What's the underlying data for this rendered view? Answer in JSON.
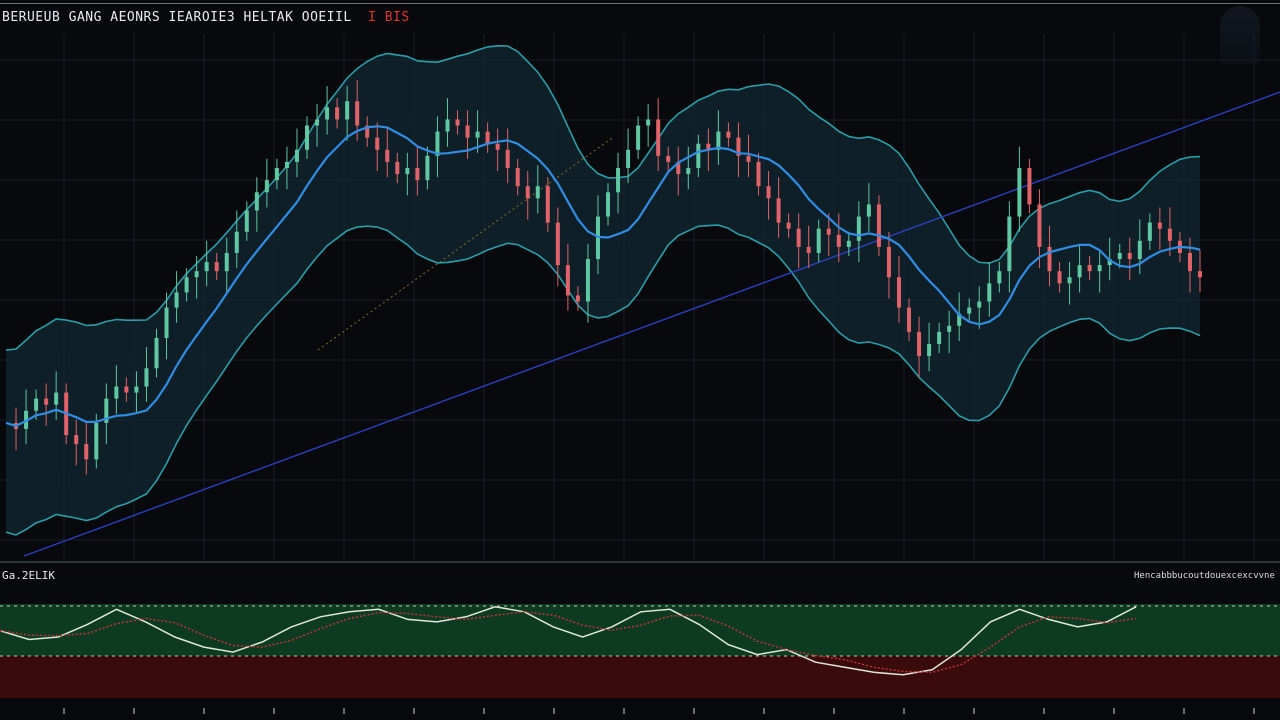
{
  "header": {
    "symbol_title": "BERUEUB GANG AEONRS IEAROIE3 HELTAK OOEIIL",
    "change_badge": "I BIS"
  },
  "oscillator": {
    "label": "Ga.2ELIK",
    "legend": "Hencabbbucoutdouexcexcvvnel"
  },
  "colors": {
    "background": "#07090c",
    "bullish": "#5fc7a2",
    "bearish": "#e0636a",
    "band": "#2a9ea8",
    "band_fill": "#122a35",
    "ma_fast": "#2f8de4",
    "ma_slow": "#2a3fc0",
    "osc_bull_zone": "#0d3b22",
    "osc_bear_zone": "#3a0b0b"
  },
  "chart_data": [
    {
      "type": "candlestick",
      "title": "",
      "indicators": [
        "bollinger_bands",
        "moving_average",
        "trend_line"
      ],
      "grid": true,
      "x": [
        0,
        10,
        20,
        30,
        40,
        50,
        60,
        70,
        80,
        90,
        100,
        110,
        120,
        130,
        140,
        150,
        160,
        170,
        180,
        190,
        200,
        210,
        220,
        230,
        240,
        250,
        260,
        270,
        280,
        290,
        300,
        310,
        320,
        330,
        340,
        350,
        360,
        370,
        380,
        390,
        400,
        410,
        420,
        430,
        440,
        450,
        460,
        470,
        480,
        490,
        500,
        510,
        520,
        530,
        540,
        550,
        560,
        570,
        580,
        590,
        600,
        610,
        620,
        630,
        640,
        650,
        660,
        670,
        680,
        690,
        700,
        710,
        720,
        730,
        740,
        750,
        760,
        770,
        780,
        790,
        800,
        810,
        820,
        830,
        840,
        850,
        860,
        870,
        880,
        890,
        900,
        910,
        920,
        930,
        940,
        950,
        960,
        970,
        980,
        990,
        1000,
        1010,
        1020,
        1030,
        1040,
        1050,
        1060,
        1070,
        1080,
        1090,
        1100,
        1110,
        1120,
        1130,
        1140,
        1150,
        1160,
        1170,
        1180,
        1190
      ],
      "close": [
        0.62,
        0.6,
        0.66,
        0.7,
        0.68,
        0.72,
        0.58,
        0.55,
        0.5,
        0.62,
        0.7,
        0.74,
        0.72,
        0.74,
        0.8,
        0.9,
        1.0,
        1.05,
        1.1,
        1.12,
        1.15,
        1.12,
        1.18,
        1.25,
        1.32,
        1.38,
        1.42,
        1.46,
        1.48,
        1.52,
        1.6,
        1.62,
        1.66,
        1.62,
        1.68,
        1.6,
        1.56,
        1.52,
        1.48,
        1.44,
        1.46,
        1.42,
        1.5,
        1.58,
        1.62,
        1.6,
        1.56,
        1.58,
        1.54,
        1.52,
        1.46,
        1.4,
        1.36,
        1.4,
        1.28,
        1.14,
        1.04,
        1.02,
        1.16,
        1.3,
        1.38,
        1.46,
        1.52,
        1.6,
        1.62,
        1.5,
        1.48,
        1.44,
        1.46,
        1.54,
        1.52,
        1.58,
        1.56,
        1.5,
        1.48,
        1.4,
        1.36,
        1.28,
        1.26,
        1.2,
        1.18,
        1.26,
        1.24,
        1.2,
        1.22,
        1.3,
        1.34,
        1.2,
        1.1,
        1.0,
        0.92,
        0.84,
        0.88,
        0.92,
        0.94,
        0.98,
        1.0,
        1.02,
        1.08,
        1.12,
        1.3,
        1.46,
        1.34,
        1.2,
        1.12,
        1.08,
        1.1,
        1.14,
        1.12,
        1.14,
        1.16,
        1.18,
        1.16,
        1.22,
        1.28,
        1.26,
        1.22,
        1.18,
        1.12,
        1.1
      ]
    },
    {
      "type": "line",
      "title": "",
      "series": [
        {
          "values": [
            0.55,
            0.48,
            0.5,
            0.6,
            0.72,
            0.62,
            0.5,
            0.42,
            0.38,
            0.46,
            0.58,
            0.66,
            0.7,
            0.72,
            0.64,
            0.62,
            0.66,
            0.74,
            0.7,
            0.58,
            0.5,
            0.58,
            0.7,
            0.72,
            0.6,
            0.44,
            0.36,
            0.4,
            0.3,
            0.26,
            0.22,
            0.2,
            0.24,
            0.4,
            0.62,
            0.72,
            0.64,
            0.58,
            0.62,
            0.74
          ]
        }
      ],
      "zones": {
        "upper": 0.68,
        "lower": 0.42
      }
    }
  ]
}
